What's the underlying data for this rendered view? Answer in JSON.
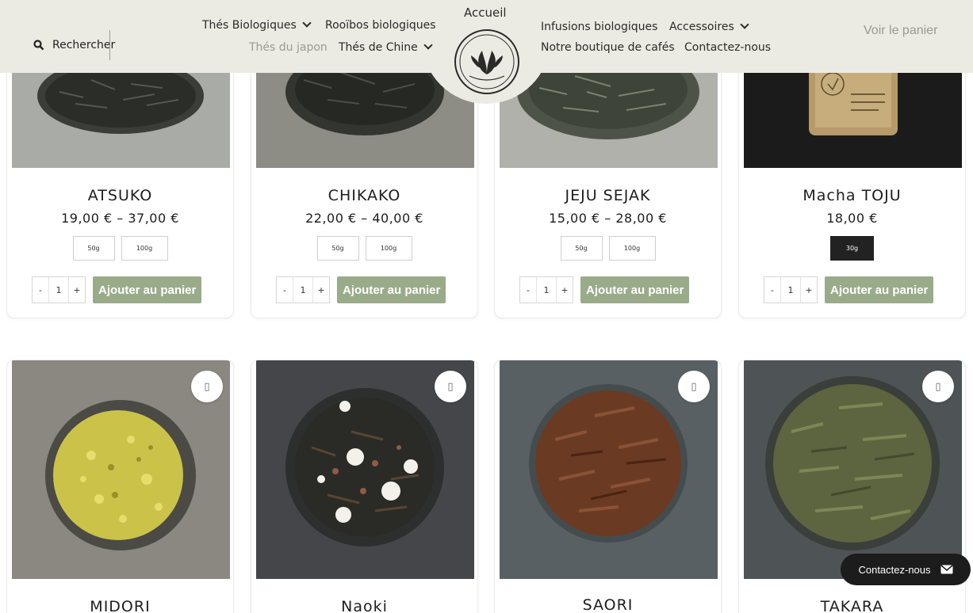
{
  "header": {
    "search_label": "Rechercher",
    "nav_left": [
      {
        "label": "Thés Biologiques",
        "has_dropdown": true
      },
      {
        "label": "Rooïbos biologiques",
        "has_dropdown": false
      },
      {
        "label": "Thés du japon",
        "has_dropdown": false,
        "current": true
      },
      {
        "label": "Thés de Chine",
        "has_dropdown": true
      }
    ],
    "home_label": "Accueil",
    "nav_right": [
      {
        "label": "Infusions biologiques",
        "has_dropdown": false
      },
      {
        "label": "Accessoires",
        "has_dropdown": true
      },
      {
        "label": "Notre boutique de cafés",
        "has_dropdown": false
      },
      {
        "label": "Contactez-nous",
        "has_dropdown": false
      }
    ],
    "cart_label": "Voir le panier",
    "logo": {
      "top_text": "les Thés du Marché",
      "bottom_text": "BIOLOGIQUE"
    }
  },
  "products": [
    {
      "name": "ATSUKO",
      "price": "19,00 €  –  37,00 €",
      "variants": [
        "50g",
        "100g"
      ],
      "selected_variant": "",
      "qty": "1",
      "add_label": "Ajouter au panier",
      "photo": "tea-dark"
    },
    {
      "name": "CHIKAKO",
      "price": "22,00 €  –  40,00 €",
      "variants": [
        "50g",
        "100g"
      ],
      "selected_variant": "",
      "qty": "1",
      "add_label": "Ajouter au panier",
      "photo": "tea-dark"
    },
    {
      "name": "JEJU SEJAK",
      "price": "15,00 €  –  28,00 €",
      "variants": [
        "50g",
        "100g"
      ],
      "selected_variant": "",
      "qty": "1",
      "add_label": "Ajouter au panier",
      "photo": "tea-light"
    },
    {
      "name": "Macha TOJU",
      "price": "18,00 €",
      "variants": [
        "30g"
      ],
      "selected_variant": "30g",
      "qty": "1",
      "add_label": "Ajouter au panier",
      "photo": "matcha-tin"
    },
    {
      "name": "MIDORI",
      "photo": "tea-yellow"
    },
    {
      "name": "Naoki",
      "photo": "tea-genmaicha"
    },
    {
      "name": "SAORI",
      "photo": "tea-hojicha"
    },
    {
      "name": "TAKARA",
      "photo": "tea-green"
    }
  ],
  "contact_button": {
    "label": "Contactez-nous",
    "icon": "envelope-icon"
  },
  "colors": {
    "header_bg": "#ecebe3",
    "add_to_cart": "#9aab8a",
    "selected_variant": "#222222",
    "contact_bg": "#1c1c1c"
  }
}
